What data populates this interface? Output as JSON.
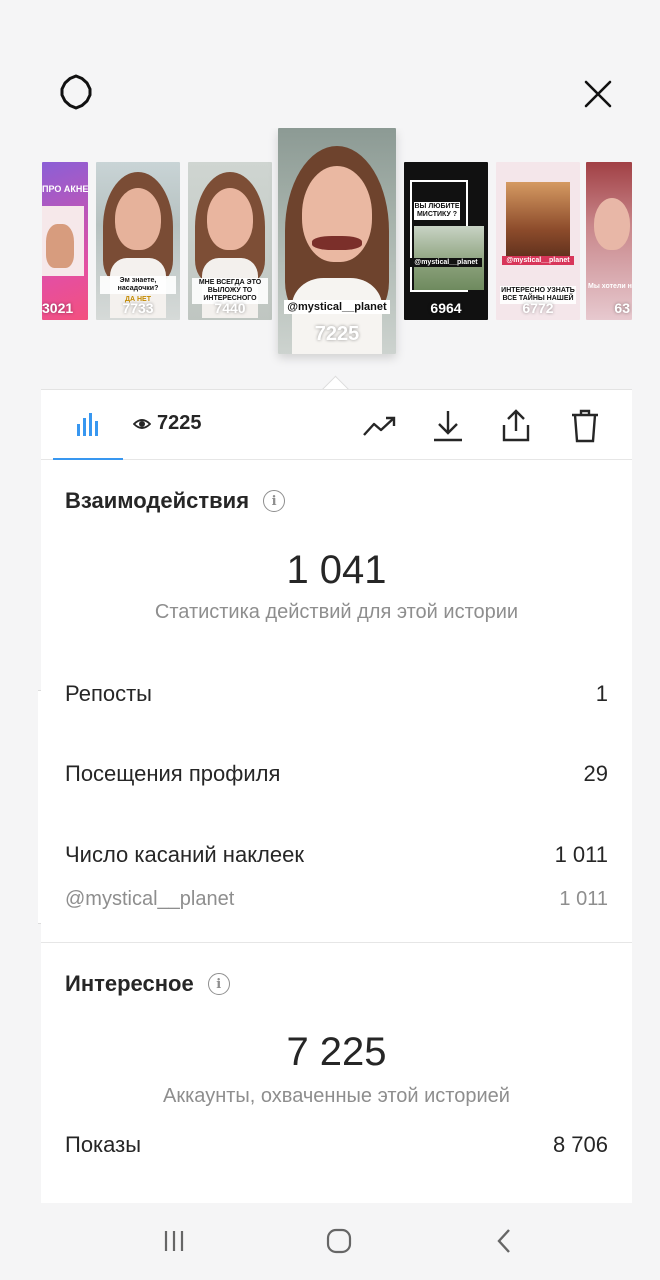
{
  "stories": [
    {
      "caption_top": "ПРО АКНЕ",
      "count": "3021"
    },
    {
      "caption": "Эм знаете, насадочки?",
      "sub": "ДА    НЕТ",
      "count": "7733"
    },
    {
      "caption": "МНЕ ВСЕГДА ЭТО ВЫЛОЖУ ТО ИНТЕРЕСНОГО",
      "count": "7440"
    },
    {
      "tag": "@mystical__planet",
      "count": "7225"
    },
    {
      "caption": "ВЫ ЛЮБИТЕ МИСТИКУ ?",
      "tag": "@mystical__planet",
      "count": "6964"
    },
    {
      "tag": "@mystical__planet",
      "caption": "ИНТЕРЕСНО УЗНАТЬ ВСЕ ТАЙНЫ НАШЕЙ",
      "count": "6772"
    },
    {
      "caption": "Мы хотели на",
      "count": "63"
    }
  ],
  "toolbar": {
    "views": "7225"
  },
  "interactions": {
    "title": "Взаимодействия",
    "total": "1 041",
    "caption": "Статистика действий для этой истории",
    "rows": [
      {
        "label": "Репосты",
        "value": "1"
      },
      {
        "label": "Посещения профиля",
        "value": "29"
      },
      {
        "label": "Число касаний наклеек",
        "value": "1 011"
      }
    ],
    "sub_row": {
      "label": "@mystical__planet",
      "value": "1 011"
    }
  },
  "discovery": {
    "title": "Интересное",
    "total": "7 225",
    "caption": "Аккаунты, охваченные этой историей",
    "rows": [
      {
        "label": "Показы",
        "value": "8 706"
      }
    ]
  },
  "colors": {
    "accent": "#3897f0",
    "background": "#f5f5f6",
    "panel": "#ffffff"
  },
  "icons": [
    "settings-icon",
    "close-icon",
    "bar-chart-icon",
    "eye-icon",
    "trend-icon",
    "download-icon",
    "share-icon",
    "trash-icon",
    "info-icon",
    "recent-apps-icon",
    "home-icon",
    "back-icon"
  ]
}
